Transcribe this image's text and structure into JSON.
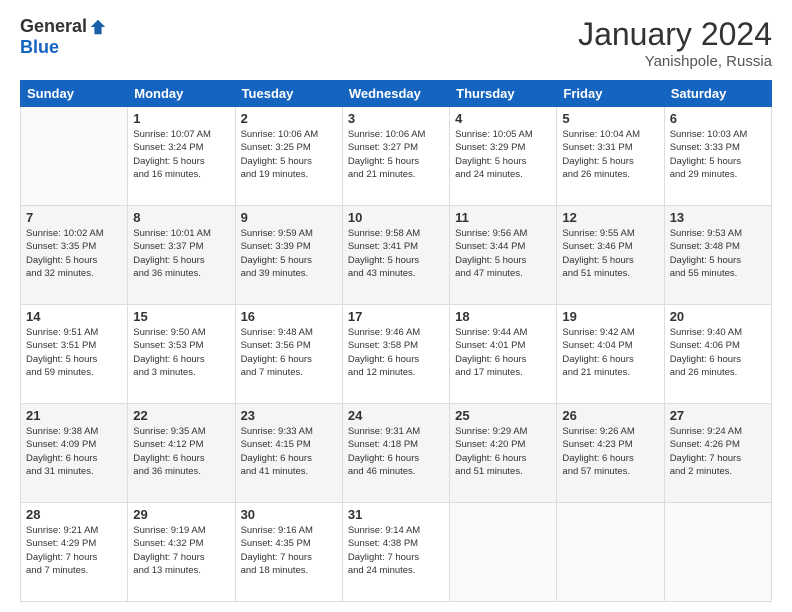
{
  "header": {
    "logo_general": "General",
    "logo_blue": "Blue",
    "title": "January 2024",
    "location": "Yanishpole, Russia"
  },
  "days_of_week": [
    "Sunday",
    "Monday",
    "Tuesday",
    "Wednesday",
    "Thursday",
    "Friday",
    "Saturday"
  ],
  "weeks": [
    [
      {
        "day": "",
        "info": ""
      },
      {
        "day": "1",
        "info": "Sunrise: 10:07 AM\nSunset: 3:24 PM\nDaylight: 5 hours\nand 16 minutes."
      },
      {
        "day": "2",
        "info": "Sunrise: 10:06 AM\nSunset: 3:25 PM\nDaylight: 5 hours\nand 19 minutes."
      },
      {
        "day": "3",
        "info": "Sunrise: 10:06 AM\nSunset: 3:27 PM\nDaylight: 5 hours\nand 21 minutes."
      },
      {
        "day": "4",
        "info": "Sunrise: 10:05 AM\nSunset: 3:29 PM\nDaylight: 5 hours\nand 24 minutes."
      },
      {
        "day": "5",
        "info": "Sunrise: 10:04 AM\nSunset: 3:31 PM\nDaylight: 5 hours\nand 26 minutes."
      },
      {
        "day": "6",
        "info": "Sunrise: 10:03 AM\nSunset: 3:33 PM\nDaylight: 5 hours\nand 29 minutes."
      }
    ],
    [
      {
        "day": "7",
        "info": "Sunrise: 10:02 AM\nSunset: 3:35 PM\nDaylight: 5 hours\nand 32 minutes."
      },
      {
        "day": "8",
        "info": "Sunrise: 10:01 AM\nSunset: 3:37 PM\nDaylight: 5 hours\nand 36 minutes."
      },
      {
        "day": "9",
        "info": "Sunrise: 9:59 AM\nSunset: 3:39 PM\nDaylight: 5 hours\nand 39 minutes."
      },
      {
        "day": "10",
        "info": "Sunrise: 9:58 AM\nSunset: 3:41 PM\nDaylight: 5 hours\nand 43 minutes."
      },
      {
        "day": "11",
        "info": "Sunrise: 9:56 AM\nSunset: 3:44 PM\nDaylight: 5 hours\nand 47 minutes."
      },
      {
        "day": "12",
        "info": "Sunrise: 9:55 AM\nSunset: 3:46 PM\nDaylight: 5 hours\nand 51 minutes."
      },
      {
        "day": "13",
        "info": "Sunrise: 9:53 AM\nSunset: 3:48 PM\nDaylight: 5 hours\nand 55 minutes."
      }
    ],
    [
      {
        "day": "14",
        "info": "Sunrise: 9:51 AM\nSunset: 3:51 PM\nDaylight: 5 hours\nand 59 minutes."
      },
      {
        "day": "15",
        "info": "Sunrise: 9:50 AM\nSunset: 3:53 PM\nDaylight: 6 hours\nand 3 minutes."
      },
      {
        "day": "16",
        "info": "Sunrise: 9:48 AM\nSunset: 3:56 PM\nDaylight: 6 hours\nand 7 minutes."
      },
      {
        "day": "17",
        "info": "Sunrise: 9:46 AM\nSunset: 3:58 PM\nDaylight: 6 hours\nand 12 minutes."
      },
      {
        "day": "18",
        "info": "Sunrise: 9:44 AM\nSunset: 4:01 PM\nDaylight: 6 hours\nand 17 minutes."
      },
      {
        "day": "19",
        "info": "Sunrise: 9:42 AM\nSunset: 4:04 PM\nDaylight: 6 hours\nand 21 minutes."
      },
      {
        "day": "20",
        "info": "Sunrise: 9:40 AM\nSunset: 4:06 PM\nDaylight: 6 hours\nand 26 minutes."
      }
    ],
    [
      {
        "day": "21",
        "info": "Sunrise: 9:38 AM\nSunset: 4:09 PM\nDaylight: 6 hours\nand 31 minutes."
      },
      {
        "day": "22",
        "info": "Sunrise: 9:35 AM\nSunset: 4:12 PM\nDaylight: 6 hours\nand 36 minutes."
      },
      {
        "day": "23",
        "info": "Sunrise: 9:33 AM\nSunset: 4:15 PM\nDaylight: 6 hours\nand 41 minutes."
      },
      {
        "day": "24",
        "info": "Sunrise: 9:31 AM\nSunset: 4:18 PM\nDaylight: 6 hours\nand 46 minutes."
      },
      {
        "day": "25",
        "info": "Sunrise: 9:29 AM\nSunset: 4:20 PM\nDaylight: 6 hours\nand 51 minutes."
      },
      {
        "day": "26",
        "info": "Sunrise: 9:26 AM\nSunset: 4:23 PM\nDaylight: 6 hours\nand 57 minutes."
      },
      {
        "day": "27",
        "info": "Sunrise: 9:24 AM\nSunset: 4:26 PM\nDaylight: 7 hours\nand 2 minutes."
      }
    ],
    [
      {
        "day": "28",
        "info": "Sunrise: 9:21 AM\nSunset: 4:29 PM\nDaylight: 7 hours\nand 7 minutes."
      },
      {
        "day": "29",
        "info": "Sunrise: 9:19 AM\nSunset: 4:32 PM\nDaylight: 7 hours\nand 13 minutes."
      },
      {
        "day": "30",
        "info": "Sunrise: 9:16 AM\nSunset: 4:35 PM\nDaylight: 7 hours\nand 18 minutes."
      },
      {
        "day": "31",
        "info": "Sunrise: 9:14 AM\nSunset: 4:38 PM\nDaylight: 7 hours\nand 24 minutes."
      },
      {
        "day": "",
        "info": ""
      },
      {
        "day": "",
        "info": ""
      },
      {
        "day": "",
        "info": ""
      }
    ]
  ]
}
